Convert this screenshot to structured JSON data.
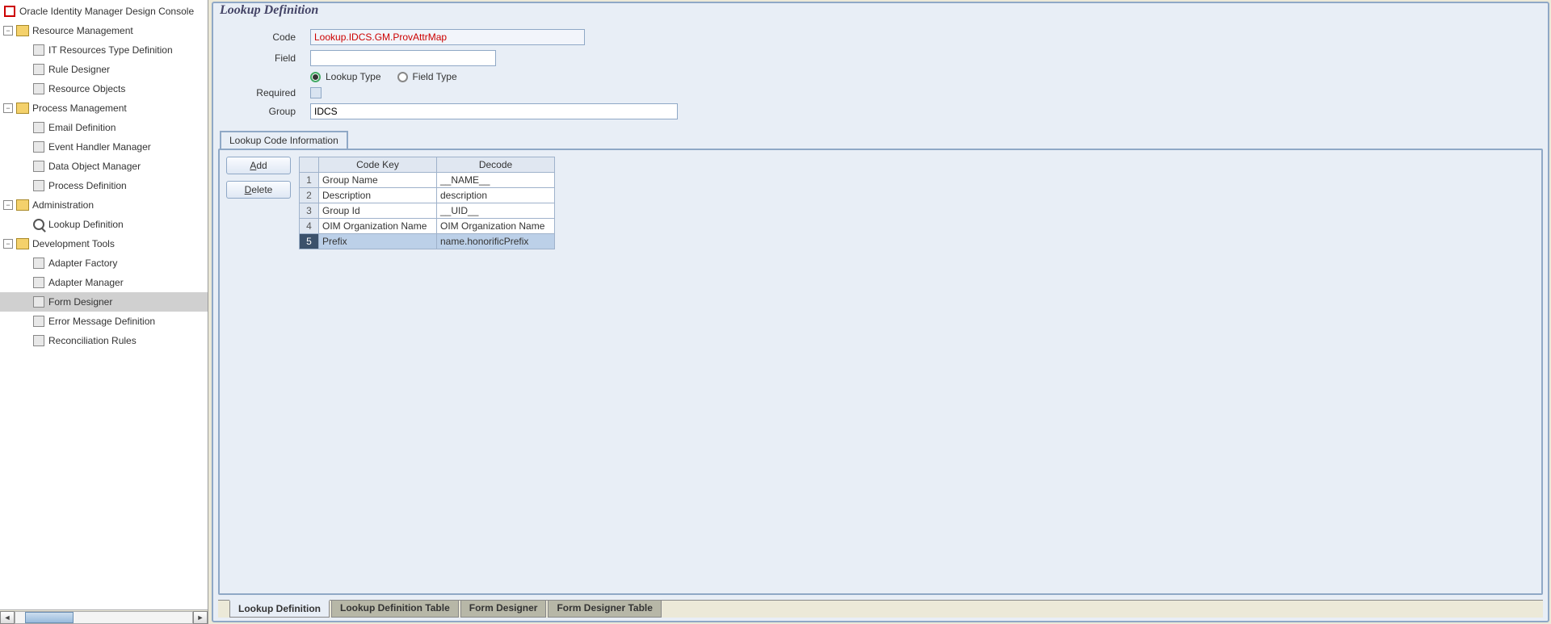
{
  "sidebar": {
    "root": "Oracle Identity Manager Design Console",
    "nodes": [
      {
        "label": "Resource Management",
        "children": [
          "IT Resources Type Definition",
          "Rule Designer",
          "Resource Objects"
        ]
      },
      {
        "label": "Process Management",
        "children": [
          "Email Definition",
          "Event Handler Manager",
          "Data Object Manager",
          "Process Definition"
        ]
      },
      {
        "label": "Administration",
        "children": [
          "Lookup Definition"
        ]
      },
      {
        "label": "Development Tools",
        "children": [
          "Adapter Factory",
          "Adapter Manager",
          "Form Designer",
          "Error Message Definition",
          "Reconciliation Rules"
        ],
        "selected_child": "Form Designer"
      }
    ]
  },
  "main": {
    "title": "Lookup Definition",
    "labels": {
      "code": "Code",
      "field": "Field",
      "required": "Required",
      "group": "Group"
    },
    "values": {
      "code": "Lookup.IDCS.GM.ProvAttrMap",
      "field": "",
      "group": "IDCS"
    },
    "type_options": {
      "lookup": "Lookup Type",
      "field": "Field Type",
      "selected": "lookup"
    },
    "required_checked": false,
    "tab_label": "Lookup Code Information",
    "buttons": {
      "add": "Add",
      "delete": "Delete"
    },
    "columns": {
      "codekey": "Code Key",
      "decode": "Decode"
    },
    "rows": [
      {
        "codekey": "Group Name",
        "decode": "__NAME__"
      },
      {
        "codekey": "Description",
        "decode": "description"
      },
      {
        "codekey": "Group Id",
        "decode": "__UID__"
      },
      {
        "codekey": "OIM Organization Name",
        "decode": "OIM Organization Name"
      },
      {
        "codekey": "Prefix",
        "decode": "name.honorificPrefix"
      }
    ],
    "selected_row": 5
  },
  "bottom_tabs": {
    "items": [
      "Lookup Definition",
      "Lookup Definition Table",
      "Form Designer",
      "Form Designer Table"
    ],
    "active_index": 0
  }
}
